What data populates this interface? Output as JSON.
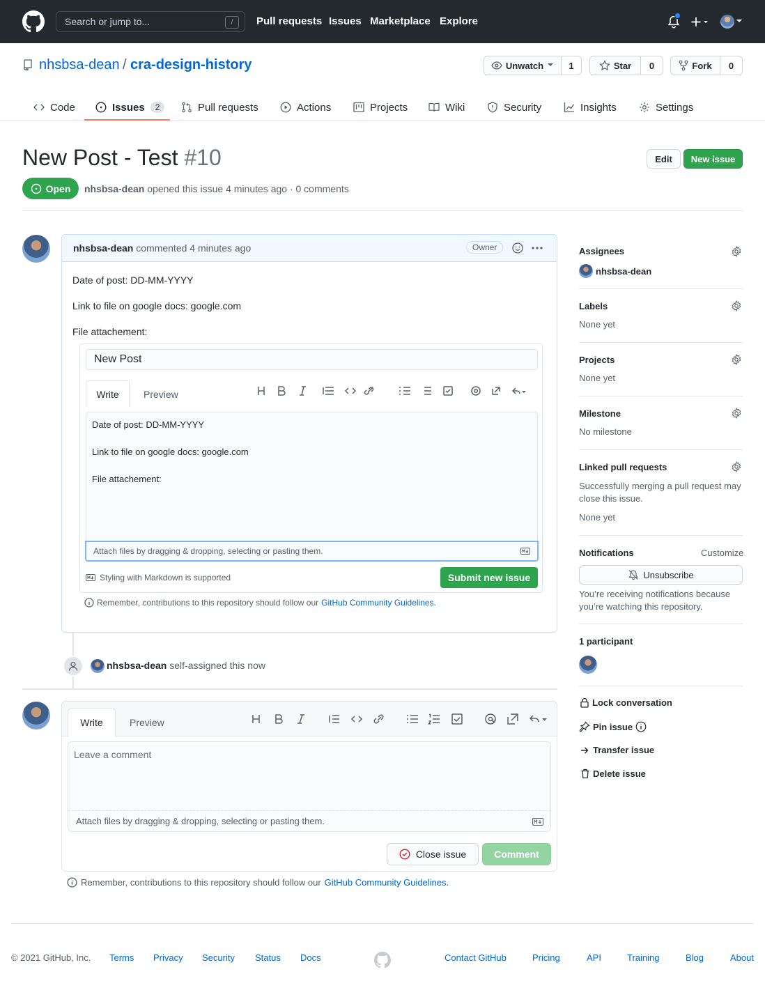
{
  "header": {
    "search_placeholder": "Search or jump to...",
    "search_key": "/",
    "nav": [
      "Pull requests",
      "Issues",
      "Marketplace",
      "Explore"
    ]
  },
  "repo": {
    "owner": "nhsbsa-dean",
    "separator": "/",
    "name": "cra-design-history",
    "unwatch": "Unwatch",
    "watch_count": "1",
    "star": "Star",
    "star_count": "0",
    "fork": "Fork",
    "fork_count": "0"
  },
  "tabs": {
    "code": "Code",
    "issues": "Issues",
    "issues_count": "2",
    "pulls": "Pull requests",
    "actions": "Actions",
    "projects": "Projects",
    "wiki": "Wiki",
    "security": "Security",
    "insights": "Insights",
    "settings": "Settings"
  },
  "issue": {
    "title": "New Post - Test",
    "number": "#10",
    "edit": "Edit",
    "new_issue": "New issue",
    "state": "Open",
    "author": "nhsbsa-dean",
    "meta": "opened this issue 4 minutes ago · 0 comments"
  },
  "comment": {
    "author": "nhsbsa-dean",
    "meta": "commented 4 minutes ago",
    "badge": "Owner",
    "line1": "Date of post: DD-MM-YYYY",
    "line2": "Link to file on google docs: google.com",
    "line3": "File attachement:",
    "embed": {
      "title_value": "New Post",
      "write": "Write",
      "preview": "Preview",
      "body_line1": "Date of post: DD-MM-YYYY",
      "body_line2": "Link to file on google docs: google.com",
      "body_line3": "File attachement:",
      "attach": "Attach files by dragging & dropping, selecting or pasting them.",
      "markdown": "Styling with Markdown is supported",
      "submit": "Submit new issue",
      "remember": "Remember, contributions to this repository should follow our",
      "guidelines": "GitHub Community Guidelines."
    }
  },
  "event": {
    "author": "nhsbsa-dean",
    "text": "self-assigned this now"
  },
  "new_comment": {
    "write": "Write",
    "preview": "Preview",
    "placeholder": "Leave a comment",
    "attach": "Attach files by dragging & dropping, selecting or pasting them.",
    "close": "Close issue",
    "comment": "Comment",
    "remember": "Remember, contributions to this repository should follow our",
    "guidelines": "GitHub Community Guidelines."
  },
  "sidebar": {
    "assignees": "Assignees",
    "assignee": "nhsbsa-dean",
    "labels": "Labels",
    "labels_val": "None yet",
    "projects": "Projects",
    "projects_val": "None yet",
    "milestone": "Milestone",
    "milestone_val": "No milestone",
    "linked": "Linked pull requests",
    "linked_desc": "Successfully merging a pull request may close this issue.",
    "linked_val": "None yet",
    "notifications": "Notifications",
    "customize": "Customize",
    "unsubscribe": "Unsubscribe",
    "notif_desc": "You’re receiving notifications because you’re watching this repository.",
    "participants": "1 participant",
    "lock": "Lock conversation",
    "pin": "Pin issue",
    "transfer": "Transfer issue",
    "delete": "Delete issue"
  },
  "footer": {
    "copyright": "© 2021 GitHub, Inc.",
    "left_links": [
      "Terms",
      "Privacy",
      "Security",
      "Status",
      "Docs"
    ],
    "right_links": [
      "Contact GitHub",
      "Pricing",
      "API",
      "Training",
      "Blog",
      "About"
    ]
  },
  "colors": {
    "header_bg": "#24292e",
    "green": "#2ea44f",
    "link": "#0366d6",
    "tab_underline": "#f9826c"
  }
}
